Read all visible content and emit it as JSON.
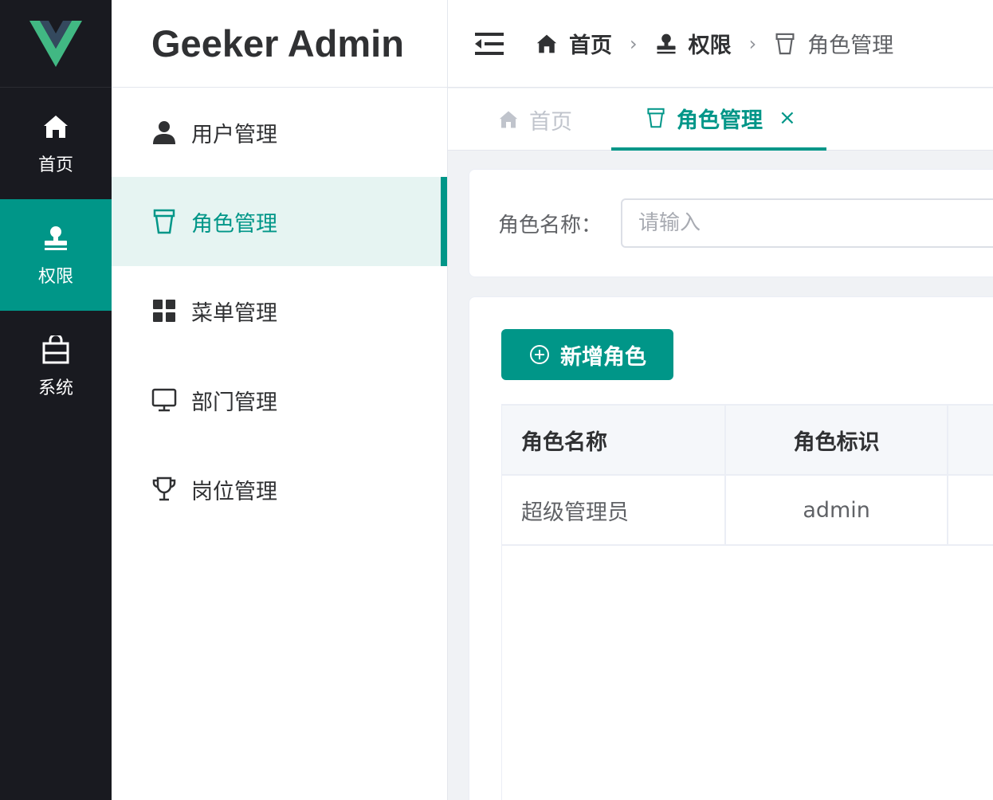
{
  "colors": {
    "accent": "#009688",
    "rail_bg": "#191a20",
    "logo_green": "#41b883",
    "logo_dark": "#34495e"
  },
  "rail": {
    "items": [
      {
        "label": "首页",
        "icon": "home-icon",
        "active": false
      },
      {
        "label": "权限",
        "icon": "stamp-icon",
        "active": true
      },
      {
        "label": "系统",
        "icon": "bag-icon",
        "active": false
      }
    ]
  },
  "brand": {
    "title": "Geeker Admin"
  },
  "submenu": {
    "items": [
      {
        "label": "用户管理",
        "icon": "user-icon"
      },
      {
        "label": "角色管理",
        "icon": "cup-icon",
        "active": true
      },
      {
        "label": "菜单管理",
        "icon": "grid-icon"
      },
      {
        "label": "部门管理",
        "icon": "monitor-icon"
      },
      {
        "label": "岗位管理",
        "icon": "trophy-icon"
      }
    ]
  },
  "header": {
    "breadcrumb": [
      {
        "label": "首页",
        "icon": "home-icon"
      },
      {
        "label": "权限",
        "icon": "stamp-icon"
      },
      {
        "label": "角色管理",
        "icon": "cup-icon"
      }
    ]
  },
  "tabs": [
    {
      "label": "首页",
      "icon": "home-icon",
      "active": false
    },
    {
      "label": "角色管理",
      "icon": "cup-icon",
      "active": true,
      "close": "×"
    }
  ],
  "search": {
    "label": "角色名称：",
    "placeholder": "请输入",
    "value": ""
  },
  "toolbar": {
    "add_label": "新增角色"
  },
  "table": {
    "columns": [
      "角色名称",
      "角色标识"
    ],
    "rows": [
      {
        "name": "超级管理员",
        "code": "admin"
      }
    ]
  }
}
